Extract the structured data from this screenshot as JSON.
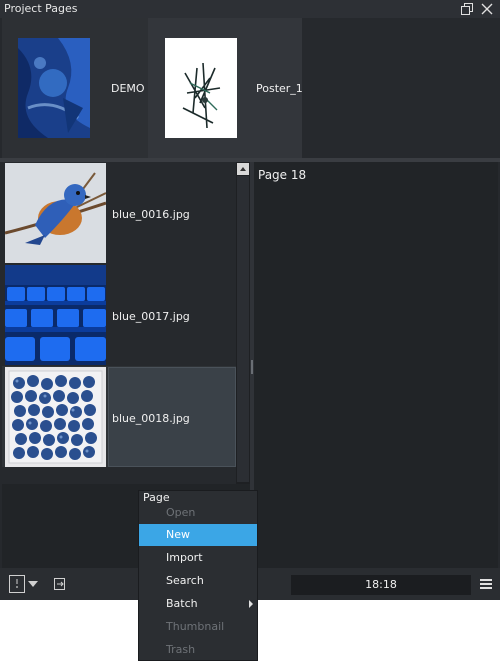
{
  "window": {
    "title": "Project Pages",
    "buttons": [
      "restore-icon",
      "close-icon"
    ]
  },
  "projects": [
    {
      "label": "DEMO",
      "thumb": "blue-abstract-painting"
    },
    {
      "label": "Poster_1",
      "thumb": "sketch-drawing"
    }
  ],
  "images": [
    {
      "name": "blue_0016.jpg",
      "thumb": "bluebird"
    },
    {
      "name": "blue_0017.jpg",
      "thumb": "blue-chairs"
    },
    {
      "name": "blue_0018.jpg",
      "thumb": "blueberries",
      "selected": true
    }
  ],
  "page_view": {
    "title": "Page 18"
  },
  "bottom": {
    "time": "18:18"
  },
  "context_menu": {
    "title": "Page",
    "items": [
      {
        "label": "Open",
        "enabled": false
      },
      {
        "label": "New",
        "enabled": true,
        "highlighted": true
      },
      {
        "label": "Import",
        "enabled": true
      },
      {
        "label": "Search",
        "enabled": true
      },
      {
        "label": "Batch",
        "enabled": true,
        "submenu": true
      },
      {
        "label": "Thumbnail",
        "enabled": false
      },
      {
        "label": "Trash",
        "enabled": false
      }
    ]
  },
  "colors": {
    "panel_bg": "#26292d",
    "menu_highlight": "#3ba6e6",
    "selection_bg": "#3a4148"
  }
}
